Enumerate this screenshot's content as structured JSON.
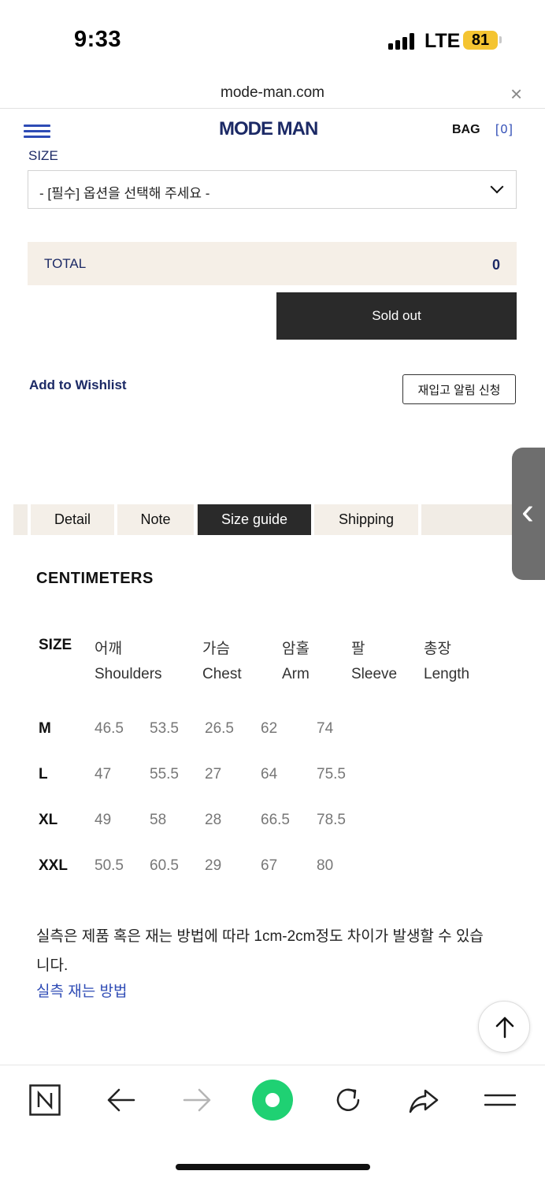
{
  "status_bar": {
    "time": "9:33",
    "network": "LTE",
    "battery": "81"
  },
  "browser": {
    "url": "mode-man.com",
    "close_symbol": "×"
  },
  "header": {
    "logo": "MODE MAN",
    "bag_label": "BAG",
    "bag_count": "[0]"
  },
  "product_options": {
    "size_label": "SIZE",
    "size_select_placeholder": "- [필수] 옵션을 선택해 주세요 -",
    "total_label": "TOTAL",
    "total_value": "0",
    "soldout_label": "Sold out",
    "wishlist_label": "Add to Wishlist",
    "restock_label": "재입고 알림 신청"
  },
  "tabs": [
    {
      "label": "Detail",
      "active": false
    },
    {
      "label": "Note",
      "active": false
    },
    {
      "label": "Size guide",
      "active": true
    },
    {
      "label": "Shipping",
      "active": false
    }
  ],
  "size_guide": {
    "unit_title": "CENTIMETERS",
    "size_header": "SIZE",
    "columns": [
      {
        "ko": "어깨",
        "en": "Shoulders"
      },
      {
        "ko": "가슴",
        "en": "Chest"
      },
      {
        "ko": "암홀",
        "en": "Arm"
      },
      {
        "ko": "팔",
        "en": "Sleeve"
      },
      {
        "ko": "총장",
        "en": "Length"
      }
    ],
    "rows": [
      {
        "size": "M",
        "values": [
          "46.5",
          "53.5",
          "26.5",
          "62",
          "74"
        ]
      },
      {
        "size": "L",
        "values": [
          "47",
          "55.5",
          "27",
          "64",
          "75.5"
        ]
      },
      {
        "size": "XL",
        "values": [
          "49",
          "58",
          "28",
          "66.5",
          "78.5"
        ]
      },
      {
        "size": "XXL",
        "values": [
          "50.5",
          "60.5",
          "29",
          "67",
          "80"
        ]
      }
    ],
    "note": "실측은 제품 혹은 재는 방법에 따라 1cm-2cm정도 차이가 발생할 수 있습니다.",
    "measure_link": "실측 재는 방법"
  },
  "toolbar": {
    "icons": [
      "naver-home-icon",
      "back-icon",
      "forward-icon",
      "green-dot-icon",
      "reload-icon",
      "share-icon",
      "menu-icon"
    ],
    "accent_green": "#1fd173"
  }
}
